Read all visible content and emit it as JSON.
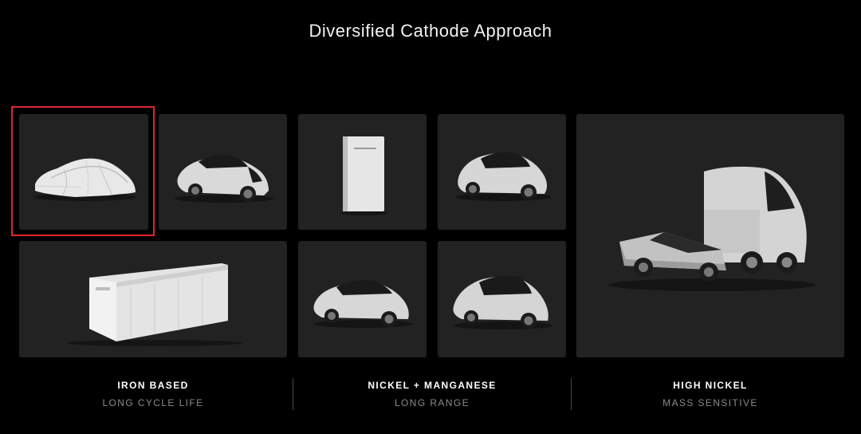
{
  "title": "Diversified Cathode Approach",
  "tiles": [
    {
      "name": "covered-vehicle",
      "selected": true
    },
    {
      "name": "model-3"
    },
    {
      "name": "powerwall"
    },
    {
      "name": "model-y"
    },
    {
      "name": "semi-and-cybertruck"
    },
    {
      "name": "megapack"
    },
    {
      "name": "model-s"
    },
    {
      "name": "model-x"
    }
  ],
  "columns": [
    {
      "label": "IRON BASED",
      "sublabel": "LONG CYCLE LIFE"
    },
    {
      "label": "NICKEL + MANGANESE",
      "sublabel": "LONG RANGE"
    },
    {
      "label": "HIGH NICKEL",
      "sublabel": "MASS SENSITIVE"
    }
  ],
  "colors": {
    "background": "#000000",
    "tile": "#222222",
    "highlight": "#e0262b",
    "sublabel": "#8a8a8a"
  }
}
